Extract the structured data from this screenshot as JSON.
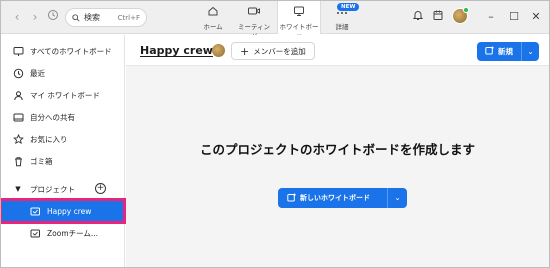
{
  "search": {
    "label": "検索",
    "shortcut": "Ctrl+F"
  },
  "nav_tabs": [
    {
      "label": "ホーム",
      "icon": "home-icon",
      "active": false
    },
    {
      "label": "ミーティング",
      "icon": "video-icon",
      "active": false
    },
    {
      "label": "ホワイトボード",
      "icon": "whiteboard-icon",
      "active": true
    },
    {
      "label": "詳細",
      "icon": "more-icon",
      "active": false
    }
  ],
  "new_badge": "NEW",
  "sidebar": {
    "items": [
      {
        "label": "すべてのホワイトボード",
        "icon": "board-icon"
      },
      {
        "label": "最近",
        "icon": "clock-icon"
      },
      {
        "label": "マイ ホワイトボード",
        "icon": "person-icon"
      },
      {
        "label": "自分への共有",
        "icon": "shared-icon"
      },
      {
        "label": "お気に入り",
        "icon": "star-icon"
      },
      {
        "label": "ゴミ箱",
        "icon": "trash-icon"
      }
    ],
    "projects_label": "プロジェクト",
    "projects": [
      {
        "label": "Happy crew",
        "selected": true
      },
      {
        "label": "Zoomチーム...",
        "selected": false
      }
    ]
  },
  "main": {
    "project_title": "Happy crew",
    "add_member_label": "メンバーを追加",
    "new_button_label": "新規",
    "heading": "このプロジェクトのホワイトボードを作成します",
    "cta_label": "新しいホワイトボード"
  },
  "colors": {
    "accent": "#1a73e8",
    "highlight": "#e8247b"
  }
}
